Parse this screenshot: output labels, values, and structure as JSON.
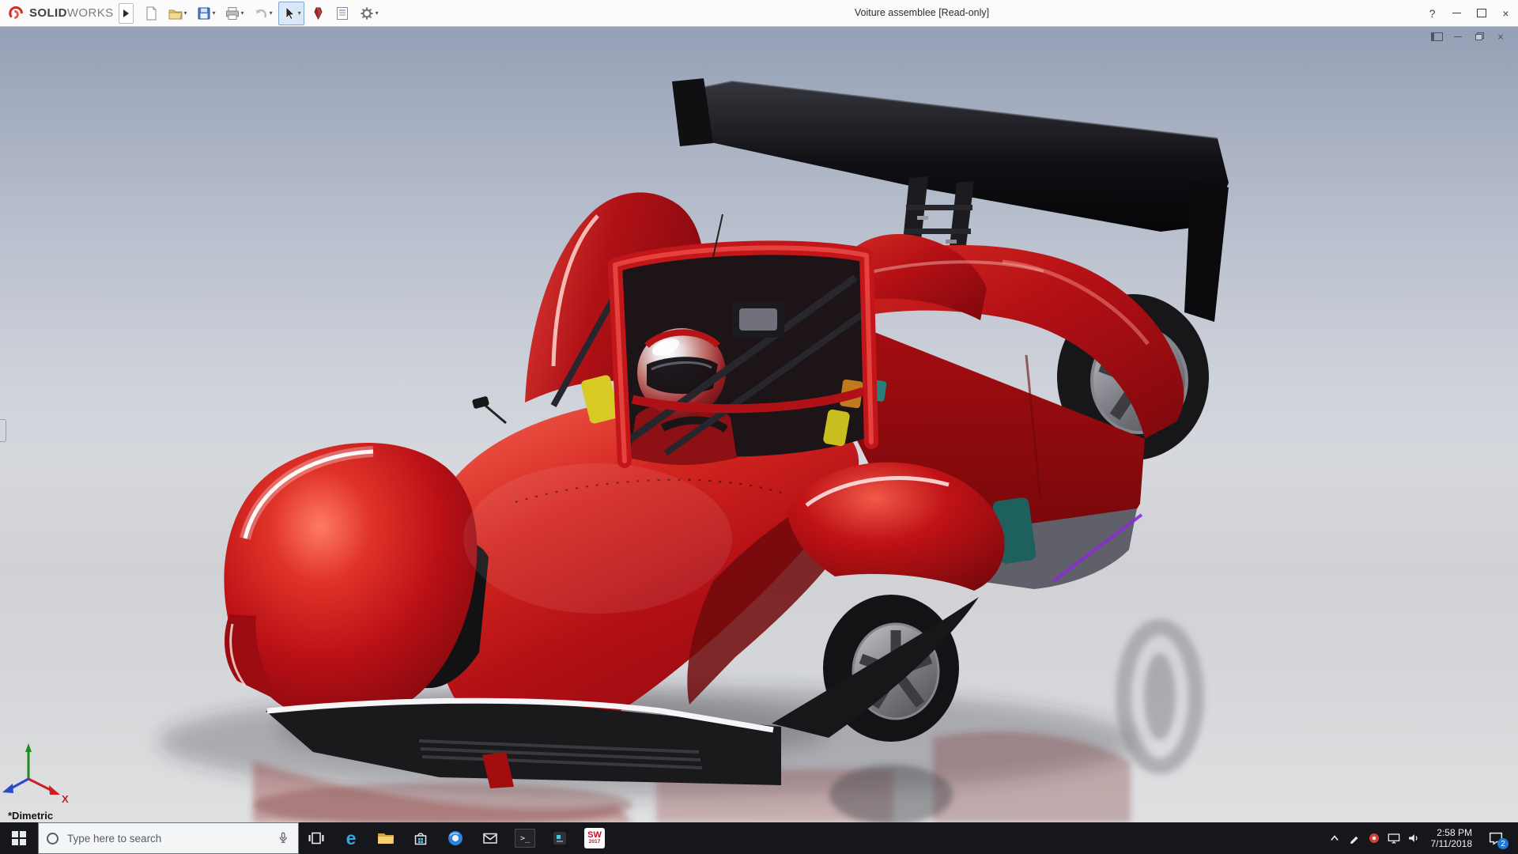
{
  "titlebar": {
    "logo_bold": "SOLID",
    "logo_light": "WORKS",
    "title": "Voiture assemblee [Read-only]",
    "help_label": "?",
    "close_glyph": "×",
    "dropdown_glyph": "▾",
    "toolbar_icons": [
      {
        "name": "new-document-icon",
        "dropdown": false
      },
      {
        "name": "open-icon",
        "dropdown": true
      },
      {
        "name": "save-icon",
        "dropdown": true
      },
      {
        "name": "print-icon",
        "dropdown": true
      },
      {
        "name": "undo-icon",
        "dropdown": true
      },
      {
        "name": "select-cursor-icon",
        "dropdown": true,
        "active": true
      },
      {
        "name": "appearance-icon",
        "dropdown": false
      },
      {
        "name": "file-properties-icon",
        "dropdown": false
      },
      {
        "name": "options-gear-icon",
        "dropdown": true
      }
    ]
  },
  "document_window": {
    "close_glyph": "×",
    "controls": [
      "dock",
      "minimize",
      "restore",
      "close"
    ]
  },
  "viewport": {
    "view_label": "*Dimetric",
    "triad": {
      "x_label": "X"
    },
    "colors": {
      "body_red": "#c41117",
      "wing_black": "#0d0d10",
      "background_top": "#95a0b6",
      "background_bottom": "#dfe0e1",
      "accent_purple": "#8a2ed8",
      "accent_teal": "#1d605e",
      "accent_yellow": "#d7ca25"
    }
  },
  "taskbar": {
    "search_placeholder": "Type here to search",
    "edge_glyph": "e",
    "terminal_glyph": "&gt;_",
    "solidworks_glyph": "SW",
    "solidworks_year": "2017",
    "icons": [
      "start",
      "search",
      "task-view",
      "edge",
      "file-explorer",
      "store",
      "browser",
      "mail",
      "terminal",
      "app",
      "solidworks"
    ],
    "tray_icons": [
      "chevron-up",
      "pen",
      "tray-app",
      "display",
      "volume"
    ],
    "tray": {
      "time": "2:58 PM",
      "date": "7/11/2018",
      "notification_count": "2"
    }
  }
}
